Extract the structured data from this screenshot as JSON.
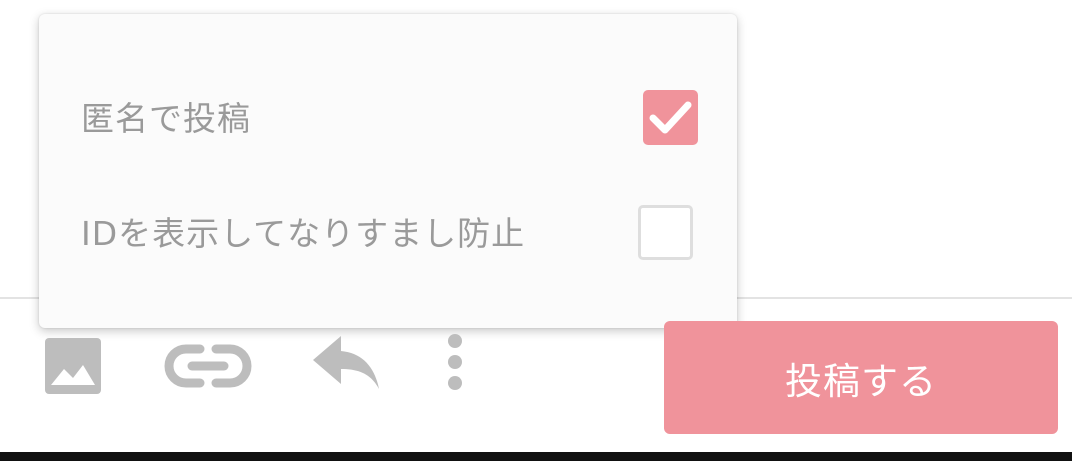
{
  "popup": {
    "options": [
      {
        "label": "匿名で投稿",
        "checked": true
      },
      {
        "label": "IDを表示してなりすまし防止",
        "checked": false
      }
    ]
  },
  "toolbar": {
    "icons": [
      "image-icon",
      "link-icon",
      "reply-icon",
      "more-vertical-icon"
    ],
    "post_button_label": "投稿する"
  },
  "colors": {
    "accent": "#f0939b",
    "icon": "#bdbdbd",
    "label_text": "#9a9a9a",
    "checkbox_border": "#dedede"
  }
}
